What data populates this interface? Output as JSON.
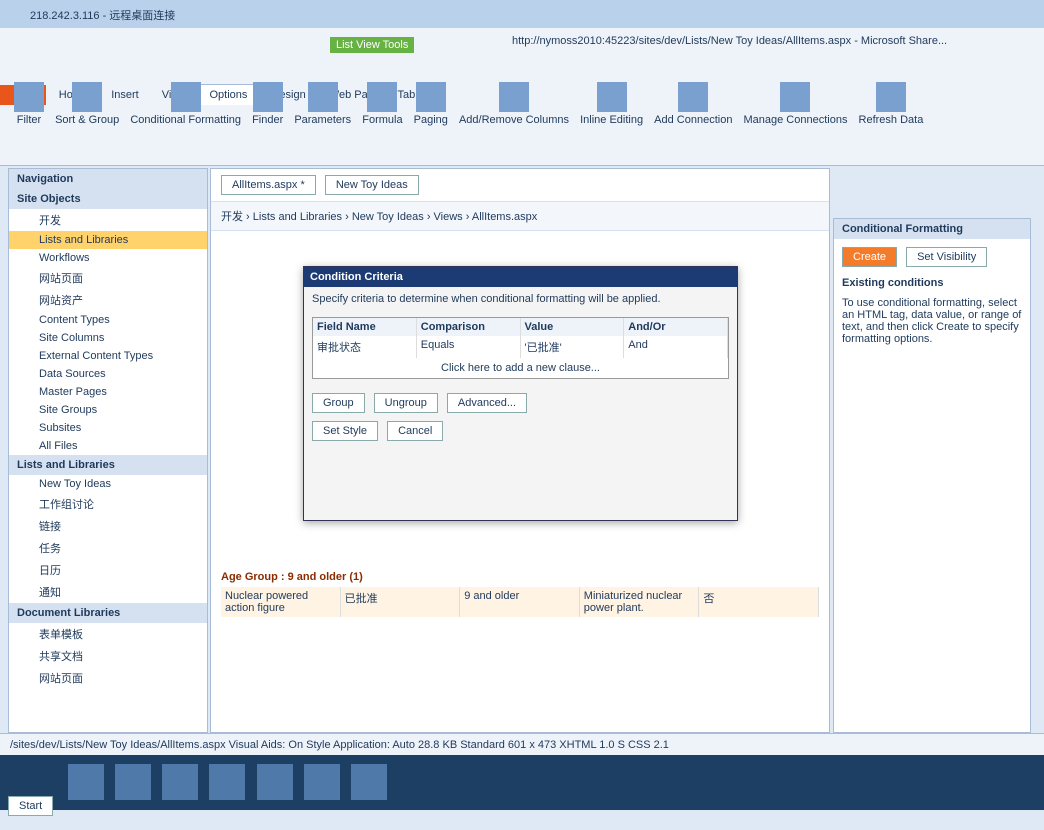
{
  "window_title": "218.242.3.116 - 远程桌面连接",
  "app_title": "http://nymoss2010:45223/sites/dev/Lists/New Toy Ideas/AllItems.aspx - Microsoft Share...",
  "list_view_tools": "List View Tools",
  "tabs": [
    "File",
    "Home",
    "Insert",
    "View",
    "Options",
    "Design",
    "Web Part",
    "Table"
  ],
  "buttons": [
    "Filter",
    "Sort & Group",
    "Conditional Formatting",
    "Finder",
    "Parameters",
    "Formula",
    "Paging",
    "Add/Remove Columns",
    "Inline Editing",
    "Add Connection",
    "Manage Connections",
    "Refresh Data"
  ],
  "nav": {
    "title": "Navigation",
    "site_objects": "Site Objects",
    "items": [
      "开发",
      "Lists and Libraries",
      "Workflows",
      "网站页面",
      "网站资产",
      "Content Types",
      "Site Columns",
      "External Content Types",
      "Data Sources",
      "Master Pages",
      "Site Groups",
      "Subsites",
      "All Files"
    ]
  },
  "lists_title": "Lists and Libraries",
  "lists": [
    "New Toy Ideas",
    "工作组讨论",
    "链接",
    "任务",
    "日历",
    "通知"
  ],
  "doclibs_title": "Document Libraries",
  "doclibs": [
    "表单模板",
    "共享文档",
    "网站页面"
  ],
  "file_tabs": [
    "AllItems.aspx *",
    "New Toy Ideas"
  ],
  "breadcrumb": "开发 › Lists and Libraries › New Toy Ideas › Views › AllItems.aspx",
  "right": {
    "title": "Conditional Formatting",
    "create": "Create",
    "set_visibility": "Set Visibility",
    "existing": "Existing conditions",
    "help": "To use conditional formatting, select an HTML tag, data value, or range of text, and then click Create to specify formatting options."
  },
  "dialog": {
    "title": "Condition Criteria",
    "desc": "Specify criteria to determine when conditional formatting will be applied.",
    "headers": [
      "Field Name",
      "Comparison",
      "Value",
      "And/Or"
    ],
    "row": [
      "审批状态",
      "Equals",
      "'已批准'",
      "And"
    ],
    "add": "Click here to add a new clause...",
    "group": "Group",
    "ungroup": "Ungroup",
    "advanced": "Advanced...",
    "setstyle": "Set Style",
    "cancel": "Cancel"
  },
  "grid_rows": [
    {
      "group": "Age Group : 9 and older (1)",
      "title": "Nuclear powered action figure",
      "status": "已批准",
      "age": "9 and older",
      "desc": "Miniaturized nuclear power plant.",
      "flag": "否"
    }
  ],
  "status": "/sites/dev/Lists/New Toy Ideas/AllItems.aspx   Visual Aids: On   Style Application: Auto   28.8 KB   Standard   601 x 473   XHTML 1.0 S   CSS 2.1",
  "start": "Start"
}
